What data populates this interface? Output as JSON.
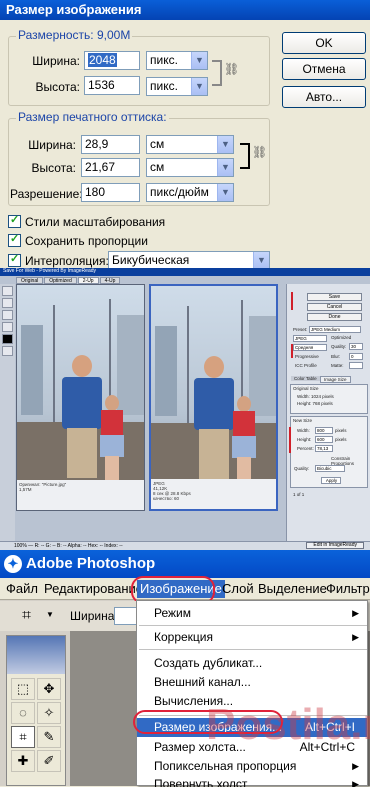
{
  "image_size_dialog": {
    "title": "Размер изображения",
    "pixel_dimensions": {
      "label": "Размерность:",
      "value": "9,00M",
      "width_label": "Ширина:",
      "width_value": "2048",
      "width_unit": "пикс.",
      "height_label": "Высота:",
      "height_value": "1536",
      "height_unit": "пикс."
    },
    "document_size": {
      "label": "Размер печатного оттиска:",
      "width_label": "Ширина:",
      "width_value": "28,9",
      "width_unit": "см",
      "height_label": "Высота:",
      "height_value": "21,67",
      "height_unit": "см",
      "resolution_label": "Разрешение:",
      "resolution_value": "180",
      "resolution_unit": "пикс/дюйм"
    },
    "options": {
      "scale_styles": "Стили масштабирования",
      "constrain": "Сохранить пропорции",
      "resample": "Интерполяция:",
      "resample_method": "Бикубическая"
    },
    "buttons": {
      "ok": "OK",
      "cancel": "Отмена",
      "auto": "Авто..."
    }
  },
  "save_for_web": {
    "title": "Save For Web - Powered By ImageReady",
    "tabs": [
      "Original",
      "Optimized",
      "2-Up",
      "4-Up"
    ],
    "left_info": "Оригинал: \"Picture.jpg\"",
    "left_size": "1,57M",
    "right_info": "JPEG",
    "right_size": "41,12K",
    "right_time": "8 сек @ 28.8 Kbps",
    "right_quality": "качество: 60",
    "buttons": {
      "save": "Save",
      "cancel": "Cancel",
      "done": "Done"
    },
    "preset_label": "Preset:",
    "preset_value": "JPEG Medium",
    "format_value": "JPEG",
    "quality_label": "Quality:",
    "quality_value": "30",
    "compression_value": "Средняя",
    "optimized_label": "Optimized",
    "progressive_label": "Progressive",
    "blur_label": "Blur:",
    "blur_value": "0",
    "icc_label": "ICC Profile",
    "matte_label": "Matte:",
    "panel_tabs": [
      "Color Table",
      "Image Size"
    ],
    "original_size_label": "Original Size",
    "orig_width": "Width: 1024 pixels",
    "orig_height": "Height: 768 pixels",
    "new_size_label": "New Size",
    "new_width_label": "Width:",
    "new_width_value": "800",
    "new_height_label": "Height:",
    "new_height_value": "600",
    "px_unit": "pixels",
    "percent_label": "Percent:",
    "percent_value": "78,13",
    "constrain_label": "Constrain Proportions",
    "quality_select_label": "Quality:",
    "quality_select_value": "Bicubic",
    "apply_label": "Apply",
    "frame_label": "1 of 1",
    "status": "100%   —   R: --   G: --   B: --   Alpha: --   Hex: --   Index: --",
    "edit_button": "Edit in ImageReady"
  },
  "photoshop": {
    "title": "Adobe Photoshop",
    "menu": [
      "Файл",
      "Редактирование",
      "Изображение",
      "Слой",
      "Выделение",
      "Фильтр"
    ],
    "options_label": "Ширина:",
    "image_menu": [
      {
        "label": "Режим",
        "shortcut": "",
        "sub": true
      },
      {
        "label": "Коррекция",
        "shortcut": "",
        "sub": true
      },
      {
        "label": "Создать дубликат...",
        "shortcut": "",
        "sub": false
      },
      {
        "label": "Внешний канал...",
        "shortcut": "",
        "sub": false
      },
      {
        "label": "Вычисления...",
        "shortcut": "",
        "sub": false
      },
      {
        "label": "Размер изображения...",
        "shortcut": "Alt+Ctrl+I",
        "sub": false
      },
      {
        "label": "Размер холста...",
        "shortcut": "Alt+Ctrl+C",
        "sub": false
      },
      {
        "label": "Попиксельная пропорция",
        "shortcut": "",
        "sub": true
      },
      {
        "label": "Повернуть холст",
        "shortcut": "",
        "sub": true
      }
    ]
  },
  "watermark": "Postila.ru",
  "colors": {
    "titlebar": "#0a5fd8",
    "dialog_bg": "#ece9d8",
    "group_label": "#1c45a8",
    "selection": "#316ac5",
    "annotation": "#e0223a"
  }
}
